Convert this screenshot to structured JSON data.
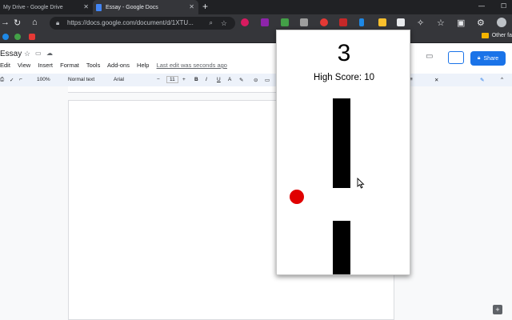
{
  "browser": {
    "tabs": [
      {
        "title": "My Drive - Google Drive",
        "active": false
      },
      {
        "title": "Essay - Google Docs",
        "active": true
      }
    ],
    "new_tab": "+",
    "url": "https://docs.google.com/document/d/1XTU...",
    "other_bookmarks": "Other fa"
  },
  "docs": {
    "title": "Essay",
    "menu": [
      "Edit",
      "View",
      "Insert",
      "Format",
      "Tools",
      "Add-ons",
      "Help"
    ],
    "last_edit": "Last edit was seconds ago",
    "share_label": "Share",
    "toolbar": {
      "zoom": "100%",
      "style": "Normal text",
      "font": "Arial",
      "font_size": "11"
    }
  },
  "game": {
    "score": "3",
    "high_score_text": "High Score: 10",
    "ball_color": "#e00000",
    "pipe_color": "#000000"
  },
  "colors": {
    "tab_strip": "#202124",
    "share": "#1a73e8"
  }
}
